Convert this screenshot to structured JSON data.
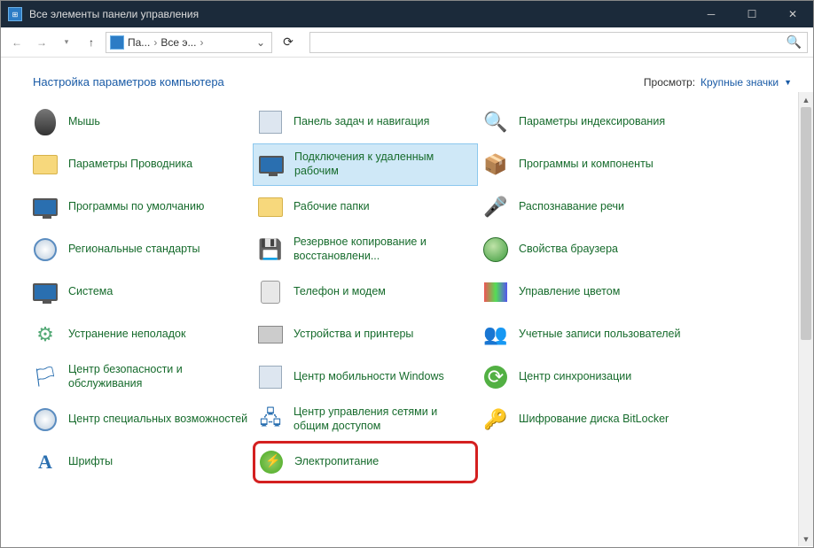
{
  "window": {
    "title": "Все элементы панели управления"
  },
  "nav": {
    "crumb1": "Па...",
    "crumb2": "Все э..."
  },
  "header": {
    "title": "Настройка параметров компьютера",
    "view_label": "Просмотр:",
    "view_value": "Крупные значки"
  },
  "items": {
    "mouse": "Мышь",
    "taskbar": "Панель задач и навигация",
    "indexing": "Параметры индексирования",
    "explorer": "Параметры Проводника",
    "rdp": "Подключения к удаленным рабочим",
    "programs": "Программы и компоненты",
    "defaults": "Программы по умолчанию",
    "workfolders": "Рабочие папки",
    "speech": "Распознавание речи",
    "region": "Региональные стандарты",
    "backup": "Резервное копирование и восстановлени...",
    "inet": "Свойства браузера",
    "system": "Система",
    "phone": "Телефон и модем",
    "color": "Управление цветом",
    "troubleshoot": "Устранение неполадок",
    "devices": "Устройства и принтеры",
    "accounts": "Учетные записи пользователей",
    "security": "Центр безопасности и обслуживания",
    "mobility": "Центр мобильности Windows",
    "sync": "Центр синхронизации",
    "ease": "Центр специальных возможностей",
    "netshare": "Центр управления сетями и общим доступом",
    "bitlocker": "Шифрование диска BitLocker",
    "fonts": "Шрифты",
    "power": "Электропитание"
  }
}
